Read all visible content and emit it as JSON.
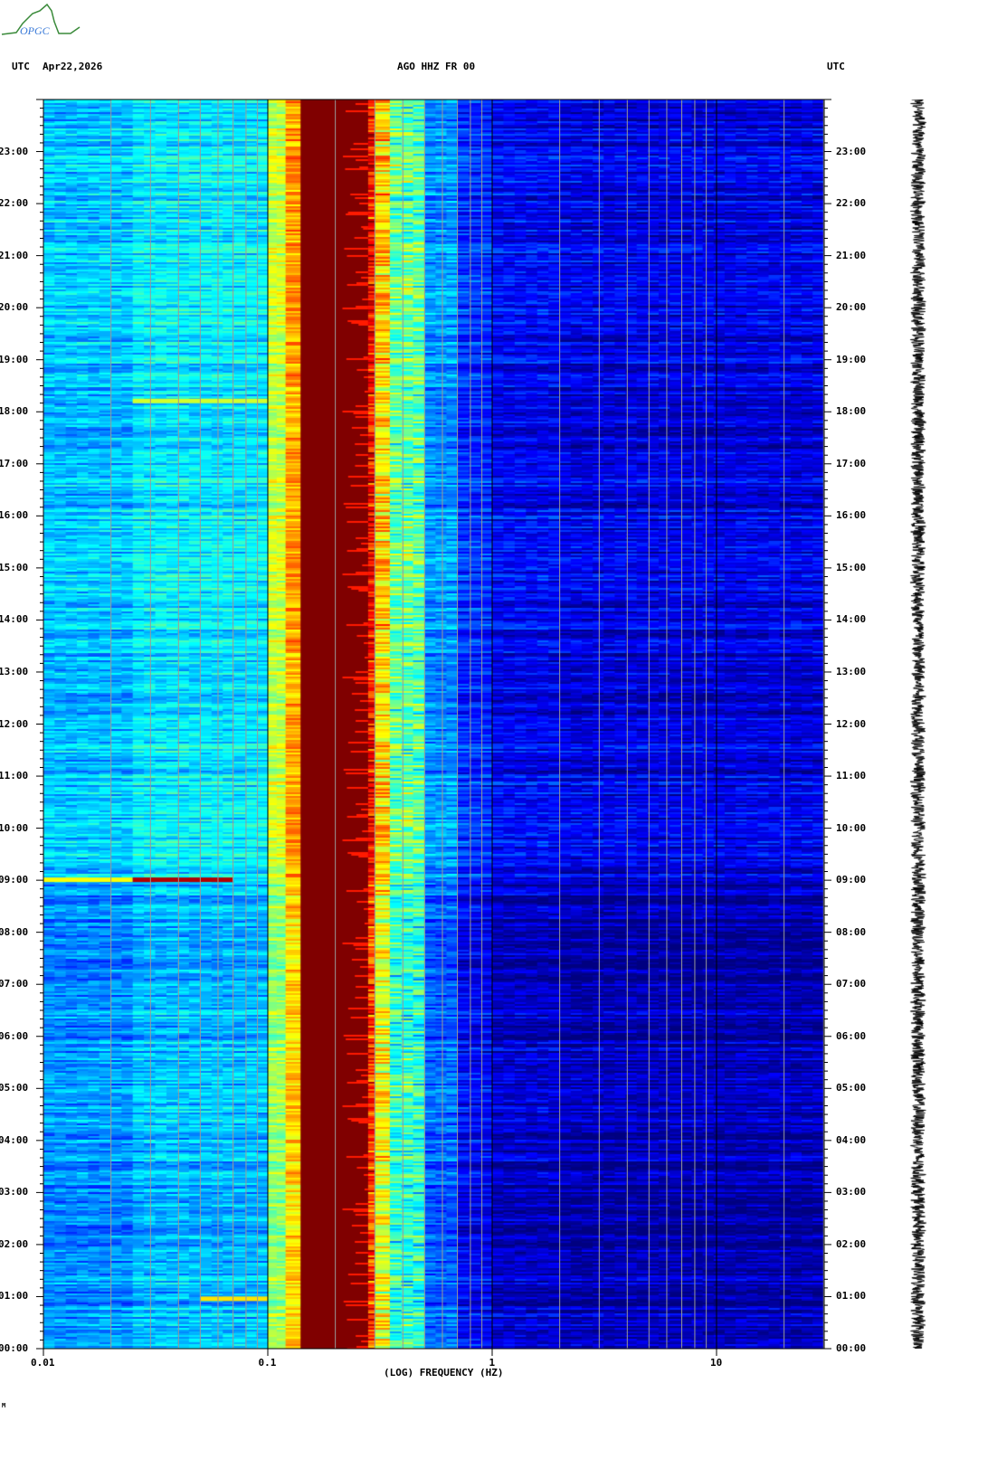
{
  "header": {
    "left_tz": "UTC",
    "date": "Apr22,2026",
    "station": "AGO HHZ FR 00",
    "right_tz": "UTC"
  },
  "logo": {
    "text": "OPGC"
  },
  "footer": {
    "mark": "M"
  },
  "chart_data": {
    "type": "heatmap",
    "title": "AGO HHZ FR 00",
    "xlabel": "(LOG) FREQUENCY (HZ)",
    "xscale": "log",
    "xlim": [
      0.01,
      30
    ],
    "x_tick_labels": [
      "0.01",
      "0.1",
      "1",
      "10"
    ],
    "x_ticks": [
      0.01,
      0.1,
      1,
      10
    ],
    "ylabel": "UTC",
    "ylim_hours": [
      0,
      24
    ],
    "y_tick_labels": [
      "00:00",
      "01:00",
      "02:00",
      "03:00",
      "04:00",
      "05:00",
      "06:00",
      "07:00",
      "08:00",
      "09:00",
      "10:00",
      "11:00",
      "12:00",
      "13:00",
      "14:00",
      "15:00",
      "16:00",
      "17:00",
      "18:00",
      "19:00",
      "20:00",
      "21:00",
      "22:00",
      "23:00"
    ],
    "colormap": "jet",
    "spectral_profile": [
      {
        "f": [
          0.01,
          0.025
        ],
        "level": 0.3
      },
      {
        "f": [
          0.025,
          0.1
        ],
        "level": 0.34
      },
      {
        "f": [
          0.1,
          0.12
        ],
        "level": 0.55
      },
      {
        "f": [
          0.12,
          0.14
        ],
        "level": 0.7
      },
      {
        "f": [
          0.14,
          0.28
        ],
        "level": 1.0
      },
      {
        "f": [
          0.28,
          0.3
        ],
        "level": 0.85
      },
      {
        "f": [
          0.3,
          0.35
        ],
        "level": 0.65
      },
      {
        "f": [
          0.35,
          0.5
        ],
        "level": 0.45
      },
      {
        "f": [
          0.5,
          0.7
        ],
        "level": 0.25
      },
      {
        "f": [
          0.7,
          1.0
        ],
        "level": 0.15
      },
      {
        "f": [
          1.0,
          2.0
        ],
        "level": 0.1
      },
      {
        "f": [
          2.0,
          30
        ],
        "level": 0.08
      }
    ],
    "events": [
      {
        "hour": 9.0,
        "f": [
          0.01,
          0.025
        ],
        "level": 0.62
      },
      {
        "hour": 9.0,
        "f": [
          0.025,
          0.07
        ],
        "level": 0.95
      },
      {
        "hour": 18.2,
        "f": [
          0.025,
          0.1
        ],
        "level": 0.58
      },
      {
        "hour": 0.95,
        "f": [
          0.05,
          0.1
        ],
        "level": 0.65
      }
    ]
  }
}
